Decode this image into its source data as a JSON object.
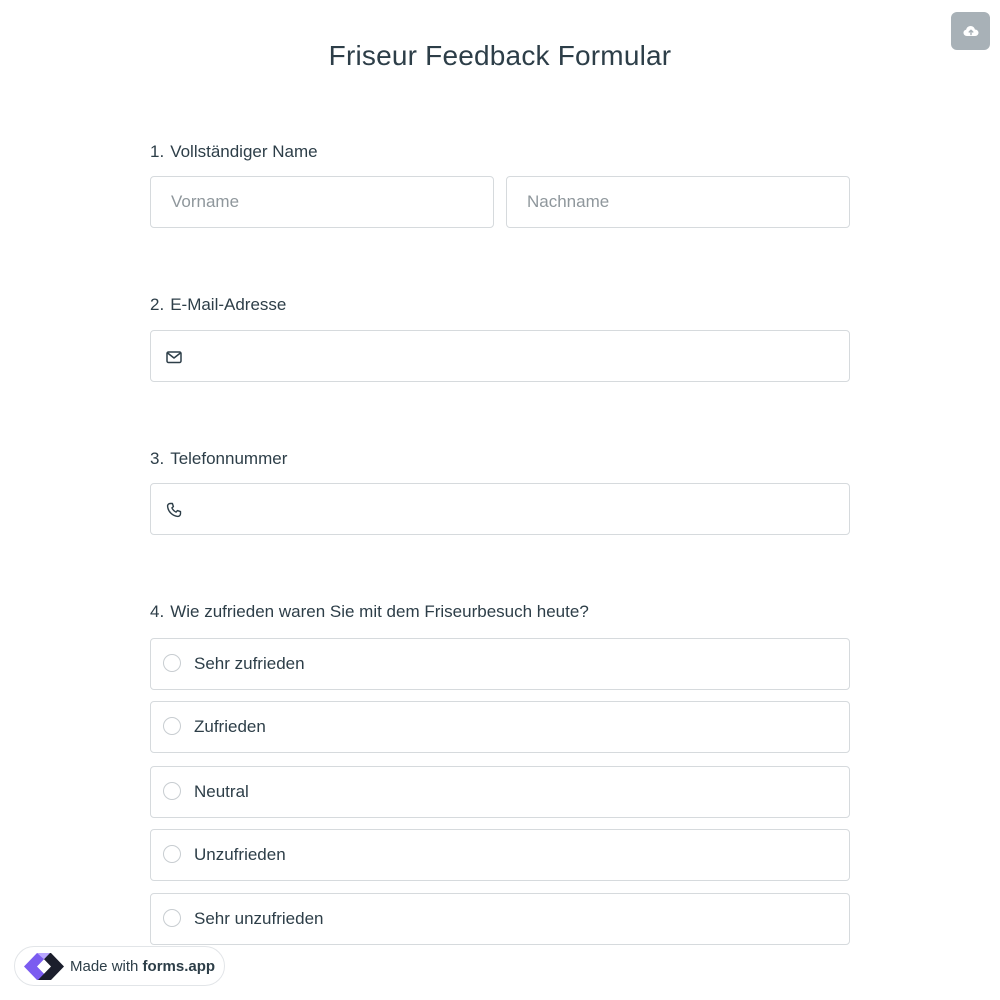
{
  "form": {
    "title": "Friseur Feedback Formular"
  },
  "toolbar": {
    "save_icon": "cloud-upload-icon"
  },
  "questions": {
    "q1": {
      "number": "1.",
      "label": "Vollständiger Name",
      "first_placeholder": "Vorname",
      "last_placeholder": "Nachname"
    },
    "q2": {
      "number": "2.",
      "label": "E-Mail-Adresse",
      "icon": "envelope-icon",
      "value": ""
    },
    "q3": {
      "number": "3.",
      "label": "Telefonnummer",
      "icon": "phone-icon",
      "value": ""
    },
    "q4": {
      "number": "4.",
      "label": "Wie zufrieden waren Sie mit dem Friseurbesuch heute?",
      "options": [
        "Sehr zufrieden",
        "Zufrieden",
        "Neutral",
        "Unzufrieden",
        "Sehr unzufrieden"
      ]
    }
  },
  "badge": {
    "prefix": "Made with",
    "brand": "forms.app",
    "icon": "forms-app-logo"
  },
  "colors": {
    "text": "#2d3e48",
    "placeholder": "#8f979c",
    "border": "#d6dadd",
    "save_button": "#a8b1b7",
    "logo_purple": "#7b5cf0",
    "logo_dark": "#1b1e2c"
  }
}
